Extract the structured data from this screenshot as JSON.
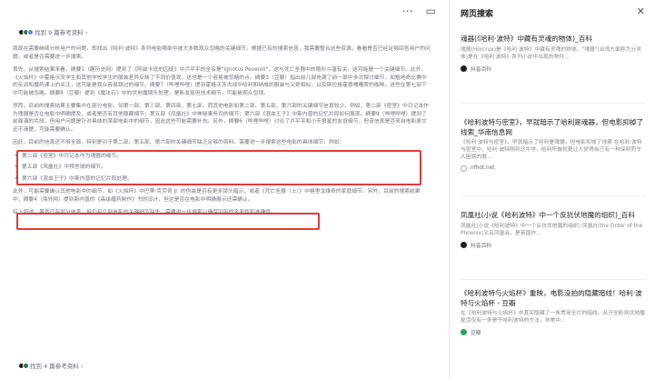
{
  "toolbar": {
    "more_icon": "more-icon",
    "close_icon": "close-icon"
  },
  "refs_top": {
    "text": "找到 9 篇参考资料 ›"
  },
  "refs_bottom": {
    "text": "找到 4 篇参考资料 ›"
  },
  "paragraphs": [
    "我现在需要继续分析用户的问题，即找出《哈利·波特》系列电影哪部中被大多数观众忽略的关键细节。根据已有的搜索信息，我需要整合这些资源，看看是否已经足够回答用户的问题，或者是否需要进一步搜索。",
    "首先，从搜索结果来看，摘要1（趣历史网）提到了《阿兹卡班的囚徒》中卢平平的全名是\"Ignotus Peverell\"，这与死亡圣器中的隐形斗篷有关，这可能是一个关键细节。此外，《火焰杯》中霍格沃茨学生和其他学校学生的服装差异反映了不同价值观，这也是一个容易被忽略的点。摘要3（豆瓣）指出前几部充满了前一部中多次探讨细节，如魁地奇比赛中的反派和魔药课上的关注，这可能是观众容易跳过的细节。摘要7（哔哩哔哩）提到霍格沃茨大战中哈利和纳威的服装与父爱相似，以及斯拉格霍恩喝嘴贾的咖啡，这些在第七部下中可能被忽略。摘要8（豆瓣）提到《魔法石》中的伏地魔镜头处理，是新发现但技术细节，可能被观众忽视。",
    "然而，目前的搜索结果主要集中在部分电影，如第一部、第三部、第四部、第七部，而其他电影如第二部、第五部、第六部的关键细节信息较少。例如，第二部《密室》中日记本作为魂器是否在电影中明确提及，或者是否有其他隐藏细节；第五部《凤凰社》中神秘事务司的细节；第六部《混血王子》中斯内普的记忆片段如何展现。摘要9（哔哩哔哩）提到了前面演的片段，但用户问题是针对具体的某部电影中的细节，因此这些可能需要补充。另外，摘要6（哔哩哔哩）讨论了卢平平和小天狼星的友谊细节，但该信息是否来自电影原文还不清楚，可能需要确认。",
    "因此，目前的信息还不够全面，特别是对于第二部、第五部、第六部的关键细节缺乏足够的资料。需要进一步搜索这些电影的具体细节，例如："
  ],
  "bullets": [
    "第二部《密室》中日记本作为魂器的细节。",
    "第五部《凤凰社》中预言球的细节。",
    "第六部《混血王子》中斯内普的记忆片段处理。"
  ],
  "paragraphs_after": [
    "此外，可能需要确认其他电影中的细节，如《火焰杯》中巴蒂·克劳奇 Jr. 的伪装是否有更多镜头暗示，或者《死亡圣器（上）》中格里戈维奇的家庭细节。另外，目前的搜索结果中，摘要4（海外网）提到斯内普的《高级魔药制作》书的设计，但这是否在电影中明确展示还需确认。",
    "综上所述，虽然已有部分信息，但仍有几部电影的关键细节缺失，需要进一步搜索以确保回答的全面性和准确性。"
  ],
  "sidebar": {
    "header": "网页搜索",
    "close_icon": "close-icon",
    "cards": [
      {
        "title": "魂器(《哈利·波特》中藏有灵魂的物体)_百科",
        "snippet": "魂器(Horcrux)是《哈利·波特》中藏有灵魂的物体，\"魂器\"(台湾方面称为分灵体)是在《哈利·波特》系列小说中出现的物件...",
        "source": "抖音百科",
        "source_icon": "douyin-icon"
      },
      {
        "title": "《哈利波特与密室》，早就暗示了哈利是魂器，但电影抑掉了线索_华南信息网",
        "snippet": "《哈利·波特与密室》，早就暗示了哈利是魂器，但电影抑掉了线索 在哈利·波特与密室中，哈利·波特刚到达中学，哈利所做就更让人觉得自己有一种深刻而令人困惑的联...",
        "source": "nfhot.net",
        "source_icon": "nfhot-icon"
      },
      {
        "title": "凤凰社(小说《哈利波特》中一个反抗伏地魔的组织)_百科",
        "snippet": "凤凰社(小说《哈利波特》中一个反抗伏地魔的组织) 凤凰社(the Order of the Phoenix)又名凤凰会，是英国作...",
        "source": "抖音百科",
        "source_icon": "douyin-icon"
      },
      {
        "title": "《哈利波特与火焰杯》重映，电影没拍的隐藏暗线！哈利·波特与火焰杯 - 豆瓣",
        "snippet": "在《哈利波特与火焰杯》中其实隐藏了一条贯穿全片的暗线。从开全影到伏地魔复活仅有一条是于哈利波特的方法，非常中...",
        "source": "豆瓣",
        "source_icon": "douban-icon"
      }
    ]
  }
}
